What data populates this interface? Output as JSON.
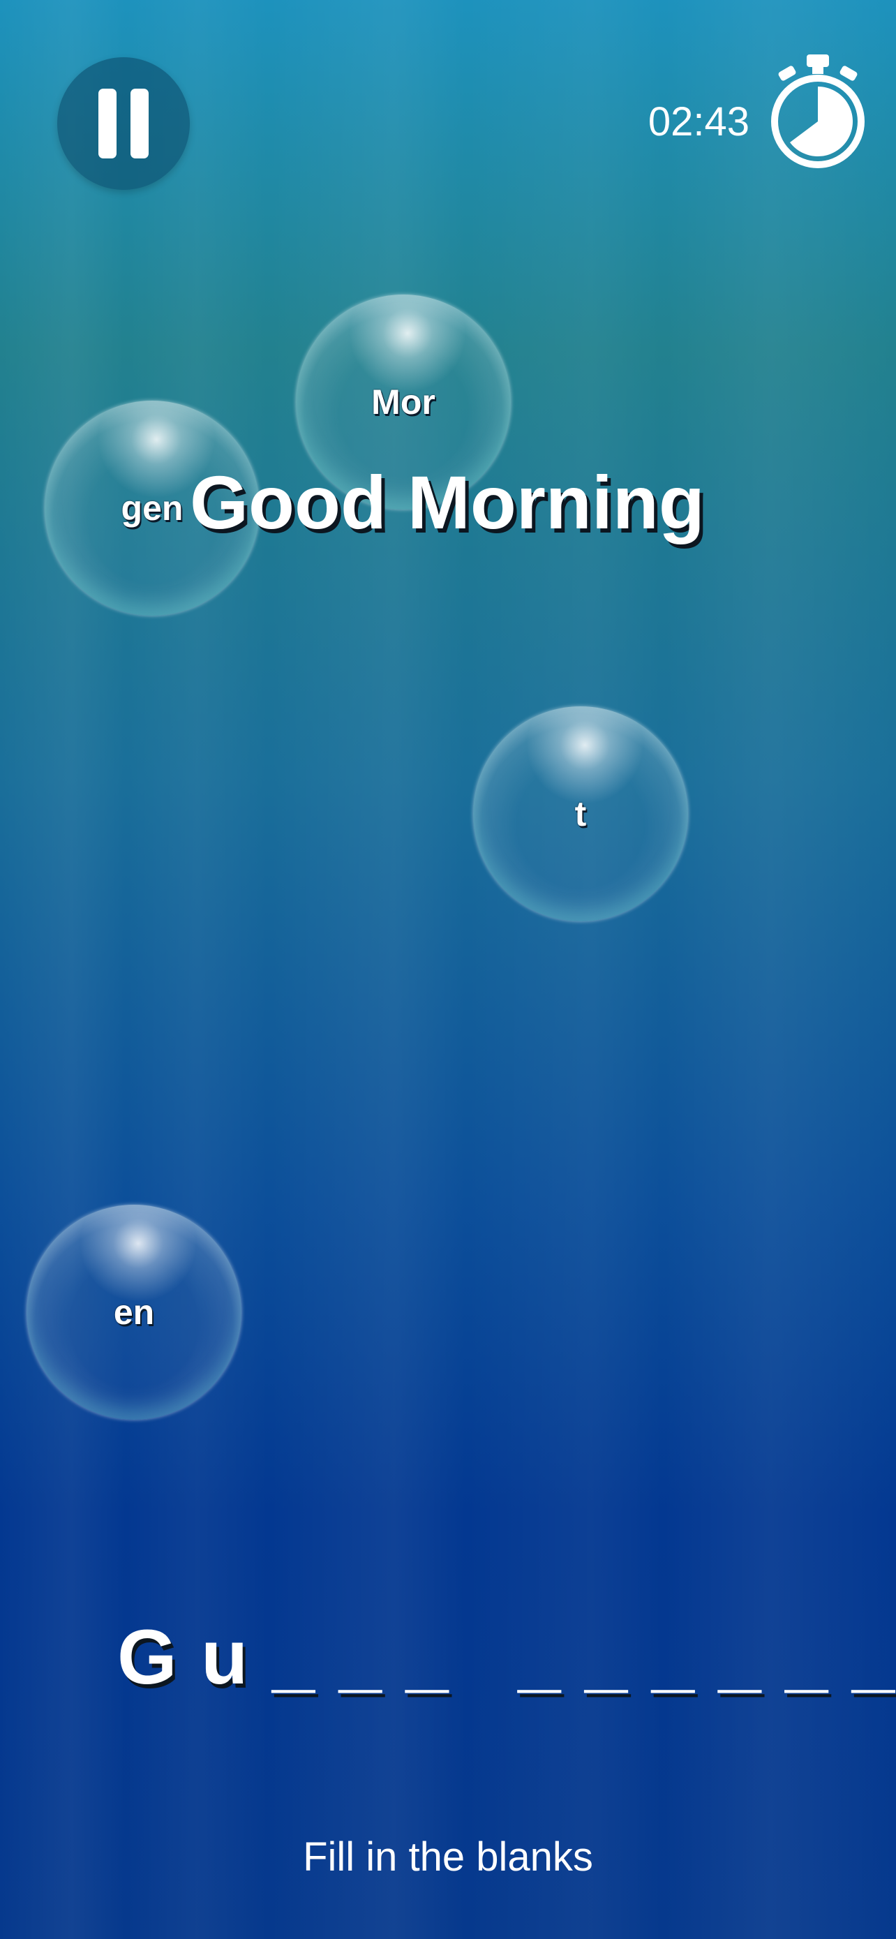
{
  "hud": {
    "timer": "02:43"
  },
  "prompt": {
    "word": "Good Morning",
    "instruction": "Fill in the blanks"
  },
  "answer": {
    "display": "G u _ _ _   _ _ _ _ _ _"
  },
  "bubbles": [
    {
      "label": "Mor"
    },
    {
      "label": "gen"
    },
    {
      "label": "t"
    },
    {
      "label": "en"
    }
  ]
}
